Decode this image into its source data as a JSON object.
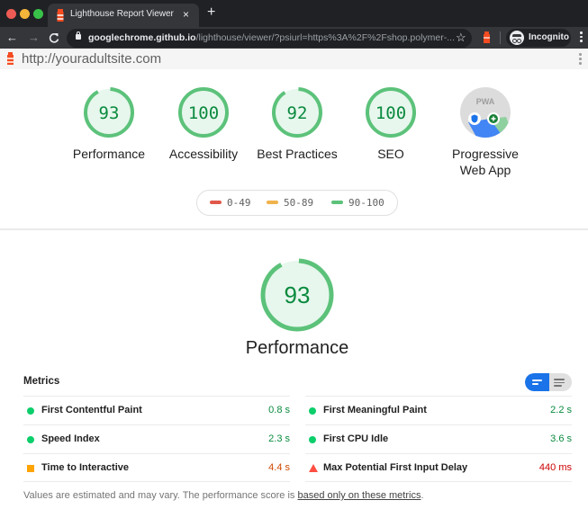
{
  "browser": {
    "tab_title": "Lighthouse Report Viewer",
    "tab_close": "×",
    "new_tab": "+",
    "url_host": "googlechrome.github.io",
    "url_path": "/lighthouse/viewer/?psiurl=https%3A%2F%2Fshop.polymer-...",
    "back": "←",
    "forward": "→",
    "reload": "C",
    "star": "☆",
    "incognito_label": "Incognito"
  },
  "report": {
    "url": "http://youradultsite.com"
  },
  "categories": [
    {
      "label": "Performance",
      "score": "93",
      "fraction": 0.93
    },
    {
      "label": "Accessibility",
      "score": "100",
      "fraction": 1.0
    },
    {
      "label": "Best Practices",
      "score": "92",
      "fraction": 0.92
    },
    {
      "label": "SEO",
      "score": "100",
      "fraction": 1.0
    }
  ],
  "pwa": {
    "label_line1": "Progressive",
    "label_line2": "Web App",
    "badge": "PWA"
  },
  "legend": [
    {
      "range": "0-49",
      "color": "#e0584a"
    },
    {
      "range": "50-89",
      "color": "#f0b34b"
    },
    {
      "range": "90-100",
      "color": "#5cc27a"
    }
  ],
  "performance": {
    "score": "93",
    "fraction": 0.93,
    "label": "Performance",
    "metrics_title": "Metrics",
    "metrics": [
      {
        "name": "First Contentful Paint",
        "value": "0.8 s",
        "rating": "pass"
      },
      {
        "name": "First Meaningful Paint",
        "value": "2.2 s",
        "rating": "pass"
      },
      {
        "name": "Speed Index",
        "value": "2.3 s",
        "rating": "pass"
      },
      {
        "name": "First CPU Idle",
        "value": "3.6 s",
        "rating": "pass"
      },
      {
        "name": "Time to Interactive",
        "value": "4.4 s",
        "rating": "average"
      },
      {
        "name": "Max Potential First Input Delay",
        "value": "440 ms",
        "rating": "fail"
      }
    ],
    "footnote_text": "Values are estimated and may vary. The performance score is ",
    "footnote_link": "based only on these metrics",
    "footnote_end": "."
  },
  "colors": {
    "pass": "#0cce6b",
    "average": "#ffa400",
    "fail": "#ff4e42",
    "accent": "#1a73e8"
  }
}
